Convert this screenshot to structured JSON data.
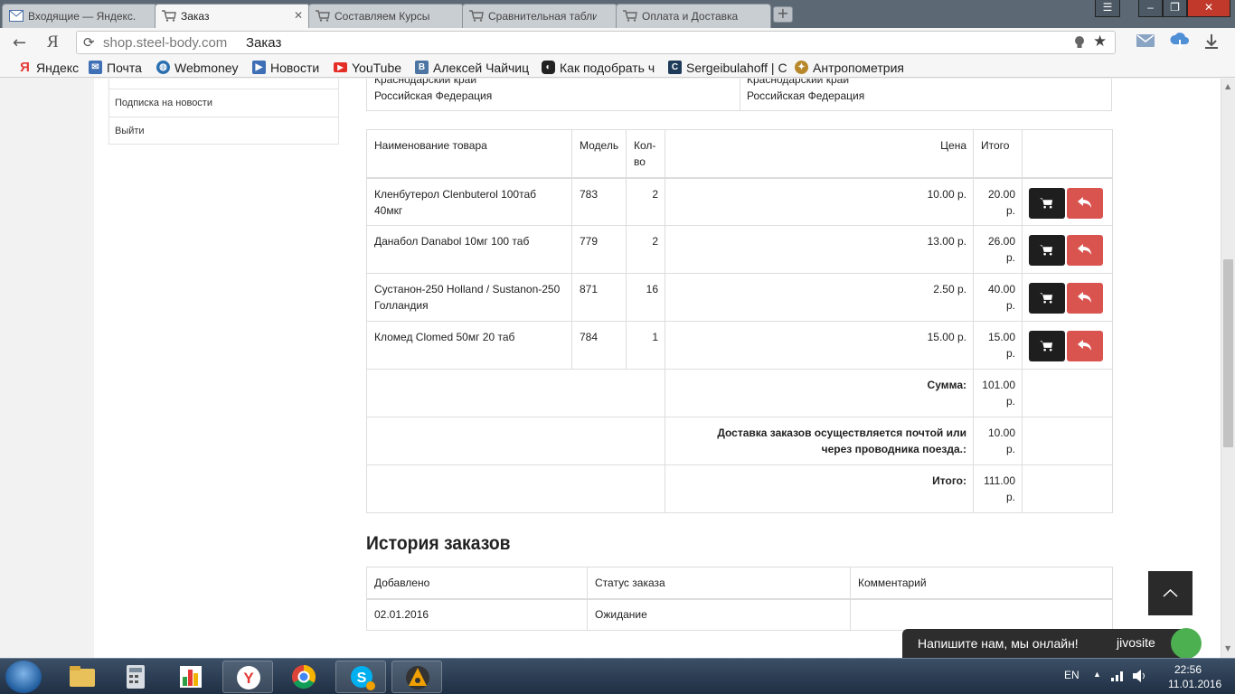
{
  "browser": {
    "tabs": [
      {
        "label": "Входящие — Яндекс.П",
        "icon": "mail-icon",
        "active": false
      },
      {
        "label": "Заказ",
        "icon": "cart-icon",
        "active": true
      },
      {
        "label": "Составляем Курсы",
        "icon": "cart-icon",
        "active": false
      },
      {
        "label": "Сравнительная табли",
        "icon": "cart-icon",
        "active": false
      },
      {
        "label": "Оплата и Доставка",
        "icon": "cart-icon",
        "active": false
      }
    ],
    "yandex_letter": "Я",
    "url_host": "shop.steel-body.com",
    "url_title": "Заказ",
    "bookmarks": [
      {
        "label": "Яндекс",
        "icon": "yandex-icon",
        "color": "#e53935"
      },
      {
        "label": "Почта",
        "icon": "mail-icon",
        "color": "#3f6fb5"
      },
      {
        "label": "Webmoney",
        "icon": "globe-icon",
        "color": "#2a6fb0"
      },
      {
        "label": "Новости",
        "icon": "play-icon",
        "color": "#3f6fb5"
      },
      {
        "label": "YouTube",
        "icon": "youtube-icon",
        "color": "#e52d27"
      },
      {
        "label": "Алексей Чайчиц",
        "icon": "vk-icon",
        "color": "#4c75a3"
      },
      {
        "label": "Как подобрать ч",
        "icon": "mask-icon",
        "color": "#222222"
      },
      {
        "label": "Sergeibulahoff | С",
        "icon": "c-icon",
        "color": "#1f3b5a"
      },
      {
        "label": "Антропометрия",
        "icon": "emblem-icon",
        "color": "#b8872a"
      }
    ]
  },
  "sidebar": {
    "items": [
      "Подписка на новости",
      "Выйти"
    ]
  },
  "shipping": {
    "left": [
      "Краснодарский край",
      "Российская Федерация"
    ],
    "right": [
      "Краснодарский край",
      "Российская Федерация"
    ]
  },
  "order": {
    "headers": {
      "name": "Наименование товара",
      "model": "Модель",
      "qty_1": "Кол-",
      "qty_2": "во",
      "price": "Цена",
      "total": "Итого"
    },
    "rows": [
      {
        "name": "Кленбутерол Clenbuterol 100таб 40мкг",
        "model": "783",
        "qty": "2",
        "price": "10.00 р.",
        "total_1": "20.00",
        "total_2": "р."
      },
      {
        "name": "Данабол Danabol 10мг 100 таб",
        "model": "779",
        "qty": "2",
        "price": "13.00 р.",
        "total_1": "26.00",
        "total_2": "р."
      },
      {
        "name": "Сустанон-250 Holland / Sustanon-250 Голландия",
        "model": "871",
        "qty": "16",
        "price": "2.50 р.",
        "total_1": "40.00",
        "total_2": "р."
      },
      {
        "name": "Кломед Clomed 50мг 20 таб",
        "model": "784",
        "qty": "1",
        "price": "15.00 р.",
        "total_1": "15.00",
        "total_2": "р."
      }
    ],
    "totals": [
      {
        "label": "Сумма:",
        "value_1": "101.00",
        "value_2": "р."
      },
      {
        "label": "Доставка заказов осуществляется почтой или через проводника поезда.:",
        "value_1": "10.00",
        "value_2": "р."
      },
      {
        "label": "Итого:",
        "value_1": "111.00",
        "value_2": "р."
      }
    ],
    "colors": {
      "reorder": "#1e1e1e",
      "return": "#d9534f"
    }
  },
  "history": {
    "title": "История заказов",
    "headers": [
      "Добавлено",
      "Статус заказа",
      "Комментарий"
    ],
    "rows": [
      {
        "date": "02.01.2016",
        "status": "Ожидание",
        "comment": ""
      }
    ]
  },
  "chat": {
    "text": "Напишите нам, мы онлайн!",
    "logo": "jivosite"
  },
  "taskbar": {
    "lang": "EN",
    "time": "22:56",
    "date": "11.01.2016"
  }
}
